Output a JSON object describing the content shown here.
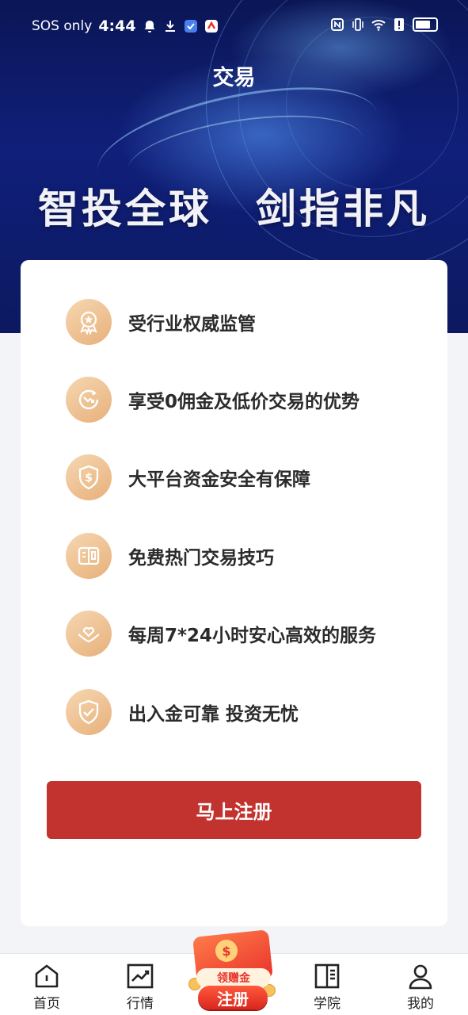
{
  "status_bar": {
    "carrier": "SOS only",
    "time": "4:44"
  },
  "header": {
    "title": "交易"
  },
  "hero": {
    "slogan": "智投全球　剑指非凡"
  },
  "features": [
    {
      "label": "受行业权威监管",
      "icon": "award-medal-icon"
    },
    {
      "label": "享受0佣金及低价交易的优势",
      "icon": "discount-icon"
    },
    {
      "label": "大平台资金安全有保障",
      "icon": "dollar-shield-icon"
    },
    {
      "label": "免费热门交易技巧",
      "icon": "book-tips-icon"
    },
    {
      "label": "每周7*24小时安心高效的服务",
      "icon": "heart-hands-icon"
    },
    {
      "label": "出入金可靠 投资无忧",
      "icon": "check-shield-icon"
    }
  ],
  "register_button": "马上注册",
  "bottom_nav": {
    "items": [
      {
        "label": "首页",
        "icon": "home-icon"
      },
      {
        "label": "行情",
        "icon": "chart-icon"
      },
      {
        "label": "学院",
        "icon": "book-icon"
      },
      {
        "label": "我的",
        "icon": "user-icon"
      }
    ],
    "promo": {
      "ribbon": "领赠金",
      "button": "注册",
      "coin": "$"
    }
  },
  "colors": {
    "accent_red": "#c2332f",
    "icon_gold": "#e7b07a",
    "hero_navy": "#0b1656"
  }
}
